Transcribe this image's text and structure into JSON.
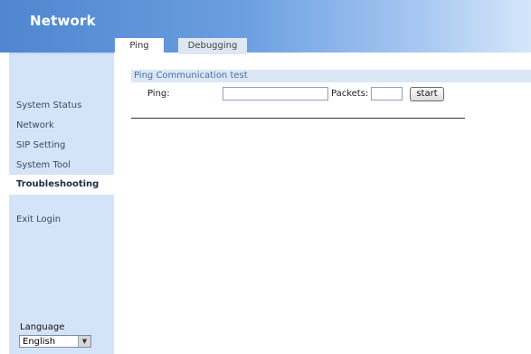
{
  "header": {
    "title": "Network"
  },
  "tabs": [
    {
      "label": "Ping",
      "active": true
    },
    {
      "label": "Debugging",
      "active": false
    }
  ],
  "sidebar": {
    "items": [
      {
        "label": "System Status"
      },
      {
        "label": "Network"
      },
      {
        "label": "SIP Setting"
      },
      {
        "label": "System Tool"
      },
      {
        "label": "Troubleshooting",
        "active": true
      },
      {
        "label": "Exit Login"
      }
    ],
    "language_label": "Language",
    "language_value": "English"
  },
  "ping_section": {
    "title": "Ping Communication test",
    "ping_label": "Ping:",
    "ping_value": "",
    "packets_label": "Packets:",
    "packets_value": "",
    "start_label": "start"
  },
  "colors": {
    "header_start": "#4f86cf",
    "sidebar_bg": "#d4e3f8",
    "section_bg": "#dce7f5",
    "section_text": "#4a6ea8"
  }
}
